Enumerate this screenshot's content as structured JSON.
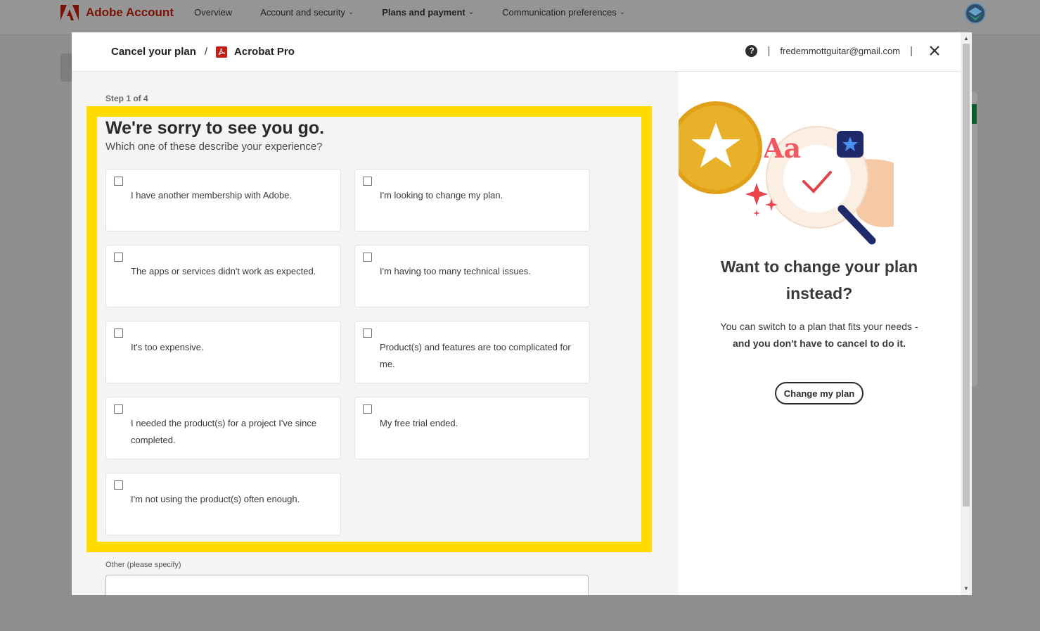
{
  "app": {
    "brand": "Adobe Account",
    "nav": [
      {
        "label": "Overview",
        "chevron": false,
        "bold": false
      },
      {
        "label": "Account and security",
        "chevron": true,
        "bold": false
      },
      {
        "label": "Plans and payment",
        "chevron": true,
        "bold": true
      },
      {
        "label": "Communication preferences",
        "chevron": true,
        "bold": false
      }
    ]
  },
  "modal": {
    "breadcrumb_cancel": "Cancel your plan",
    "breadcrumb_separator": "/",
    "breadcrumb_product": "Acrobat Pro",
    "help_icon": "?",
    "email": "fredemmottguitar@gmail.com",
    "step": "Step 1 of 4",
    "title": "We're sorry to see you go.",
    "subtitle": "Which one of these describe your experience?",
    "options": [
      {
        "label": "I have another membership with Adobe.",
        "checked": false
      },
      {
        "label": "I'm looking to change my plan.",
        "checked": false
      },
      {
        "label": "The apps or services didn't work as expected.",
        "checked": false
      },
      {
        "label": "I'm having too many technical issues.",
        "checked": false
      },
      {
        "label": "It's too expensive.",
        "checked": false
      },
      {
        "label": "Product(s) and features are too complicated for me.",
        "checked": false
      },
      {
        "label": "I needed the product(s) for a project I've since completed.",
        "checked": false
      },
      {
        "label": "My free trial ended.",
        "checked": false
      },
      {
        "label": "I'm not using the product(s) often enough.",
        "checked": false
      }
    ],
    "other_label": "Other (please specify)",
    "other_value": "",
    "promo": {
      "illustration_text": "Aa",
      "title": "Want to change your plan instead?",
      "desc_line1": "You can switch to a plan that fits your needs -",
      "desc_line2": "and you don't have to cancel to do it.",
      "button": "Change my plan"
    }
  },
  "colors": {
    "brand_red": "#eb1000",
    "highlight": "#ffdb00",
    "acrobat_red": "#c61b16"
  }
}
